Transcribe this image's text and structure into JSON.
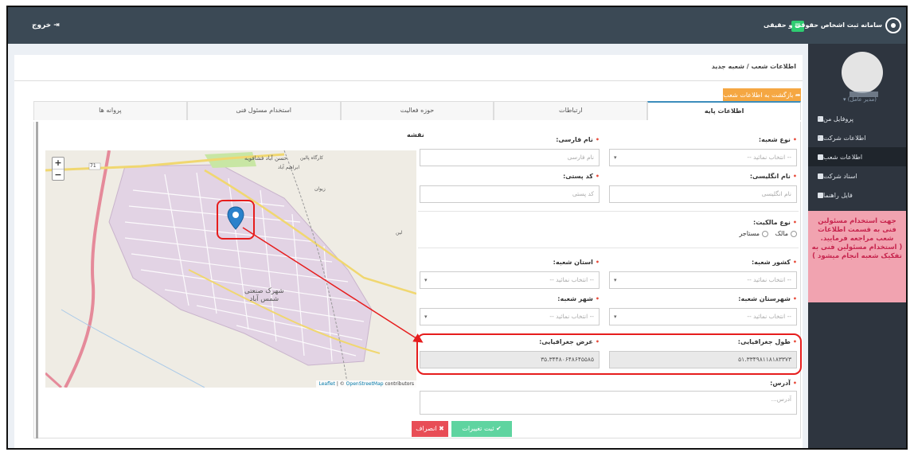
{
  "app": {
    "brand": "سامانه ثبت اشخاص حقوقی و حقیقی",
    "logout": "خروج",
    "menu_icon": "hamburger-icon"
  },
  "user": {
    "role": "(مدیر عامل) ▾"
  },
  "sidebar": {
    "items": [
      {
        "label": "پروفایل من",
        "icon": "user-icon",
        "has_submenu": true
      },
      {
        "label": "اطلاعات شرکت",
        "icon": "grid-icon",
        "has_submenu": true
      },
      {
        "label": "اطلاعات شعب",
        "icon": "grid-icon",
        "has_submenu": false,
        "active": true
      },
      {
        "label": "اسناد شرکت",
        "icon": "users-icon",
        "has_submenu": false
      },
      {
        "label": "فایل راهنما",
        "icon": "file-icon",
        "has_submenu": false
      }
    ],
    "notice": {
      "line1": "جهت استخدام مسئولین فنی به قسمت اطلاعات شعب مراجعه فرمایید.",
      "line2": "( استخدام مسئولین فنی به تفکیک شعبه انجام میشود )"
    }
  },
  "page": {
    "breadcrumb": "اطلاعات شعب / شعبه جدید",
    "back_button": "بازگشت به اطلاعات شعب"
  },
  "tabs": [
    {
      "label": "اطلاعات پایه",
      "active": true
    },
    {
      "label": "ارتباطات",
      "active": false
    },
    {
      "label": "حوزه فعالیت",
      "active": false
    },
    {
      "label": "استخدام مسئول فنی",
      "active": false
    },
    {
      "label": "پروانه ها",
      "active": false
    }
  ],
  "form": {
    "branch_type": {
      "label": "نوع شعبه:",
      "placeholder": "-- انتخاب نمائید --"
    },
    "persian_name": {
      "label": "نام فارسی:",
      "placeholder": "نام فارسی"
    },
    "english_name": {
      "label": "نام انگلیسی:",
      "placeholder": "نام انگلیسی"
    },
    "postal_code": {
      "label": "کد پستی:",
      "placeholder": "کد پستی"
    },
    "ownership": {
      "label": "نوع مالکیت:",
      "options": [
        "مالک",
        "مستاجر"
      ]
    },
    "country": {
      "label": "کشور شعبه:",
      "placeholder": "-- انتخاب نمائید --"
    },
    "province": {
      "label": "استان شعبه:",
      "placeholder": "-- انتخاب نمائید --"
    },
    "county": {
      "label": "شهرستان شعبه:",
      "placeholder": "-- انتخاب نمائید --"
    },
    "city": {
      "label": "شهر شعبه:",
      "placeholder": "-- انتخاب نمائید --"
    },
    "longitude": {
      "label": "طول جغرافیایی:",
      "value": "۵۱.۳۳۴۹۸۱۱۸۱۸۳۳۷۳"
    },
    "latitude": {
      "label": "عرض جغرافیایی:",
      "value": "۳۵.۳۴۴۸۰۶۴۸۶۴۵۵۸۵"
    },
    "address": {
      "label": "آدرس:",
      "placeholder": "آدرس..."
    },
    "save_button": "ثبت تغییرات",
    "cancel_button": "انصراف"
  },
  "map": {
    "label": "نقشه",
    "zoom_in": "+",
    "zoom_out": "−",
    "attribution_leaflet": "Leaflet",
    "attribution_sep": " | © ",
    "attribution_osm": "OpenStreetMap",
    "attribution_tail": " contributors",
    "place_main_1": "شهرک صنعتی",
    "place_main_2": "شمس آباد",
    "place_hasan": "حسن آباد فشافویه",
    "place_ibrahim": "ابراهیم آباد",
    "place_kargah": "کارگاه پالین",
    "place_zivan": "زیوان",
    "place_lien": "لین",
    "road_num": "71",
    "colors": {
      "industrial": "#e3d4e6",
      "road": "#f2e08b",
      "highway": "#e58a9a"
    }
  }
}
